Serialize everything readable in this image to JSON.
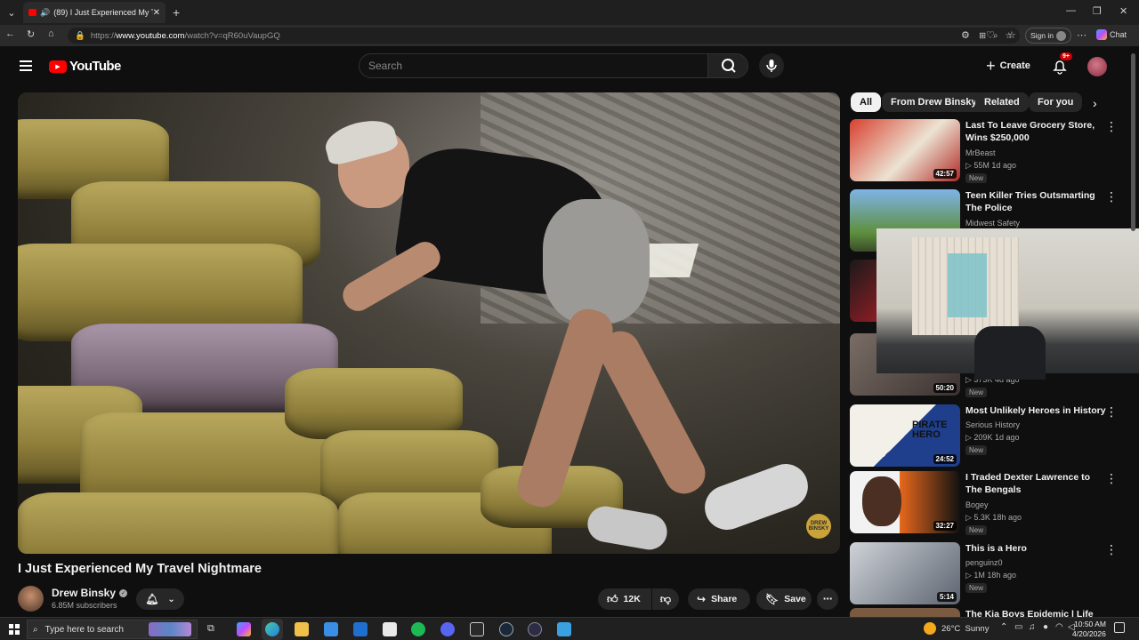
{
  "browser": {
    "tab_title": "(89) I Just Experienced My Tra",
    "url_prefix": "https://",
    "url_host": "www.youtube.com",
    "url_path": "/watch?v=qR60uVaupGQ",
    "signin_label": "Sign in",
    "chat_label": "Chat"
  },
  "youtube": {
    "logo_text": "YouTube",
    "search_placeholder": "Search",
    "create_label": "Create",
    "notif_badge": "9+"
  },
  "video": {
    "title": "I Just Experienced My Travel Nightmare",
    "channel": "Drew Binsky",
    "subscribers": "6.85M subscribers",
    "likes": "12K",
    "share_label": "Share",
    "save_label": "Save",
    "watermark": "DREW BINSKY"
  },
  "chips": [
    {
      "label": "All"
    },
    {
      "label": "From Drew Binsky"
    },
    {
      "label": "Related"
    },
    {
      "label": "For you"
    }
  ],
  "recommendations": [
    {
      "title": "Last To Leave Grocery Store, Wins $250,000",
      "channel": "MrBeast",
      "meta": "▷ 55M  1d ago",
      "badge": "New",
      "duration": "42:57",
      "thumb_color": "#c9352b"
    },
    {
      "title": "Teen Killer Tries Outsmarting The Police",
      "channel": "Midwest Safety",
      "meta": "",
      "badge": "",
      "duration": "",
      "thumb_color": "#3f6ea3"
    },
    {
      "title": "",
      "channel": "",
      "meta": "",
      "badge": "",
      "duration": "",
      "thumb_color": "#c8202a"
    },
    {
      "title": "",
      "channel": "",
      "meta": "▷ 373K  4d ago",
      "badge": "New",
      "duration": "50:20",
      "thumb_color": "#5a4f4a"
    },
    {
      "title": "Most Unlikely Heroes in History",
      "channel": "Serious History",
      "meta": "▷ 209K  1d ago",
      "badge": "New",
      "duration": "24:52",
      "thumb_color": "#2a4f9c"
    },
    {
      "title": "I Traded Dexter Lawrence to The Bengals",
      "channel": "Bogey",
      "meta": "▷ 5.3K  18h ago",
      "badge": "New",
      "duration": "32:27",
      "thumb_color": "#e8681c"
    },
    {
      "title": "This is a Hero",
      "channel": "penguinz0",
      "meta": "▷ 1M  18h ago",
      "badge": "New",
      "duration": "5:14",
      "thumb_color": "#6c7580"
    },
    {
      "title": "The Kia Boys Epidemic | Life as...",
      "channel": "",
      "meta": "",
      "badge": "",
      "duration": "",
      "thumb_color": "#7a5a40"
    }
  ],
  "taskbar": {
    "search_placeholder": "Type here to search",
    "weather": "26°C  Sunny",
    "time": "10:50 AM",
    "date": "4/20/2026"
  }
}
